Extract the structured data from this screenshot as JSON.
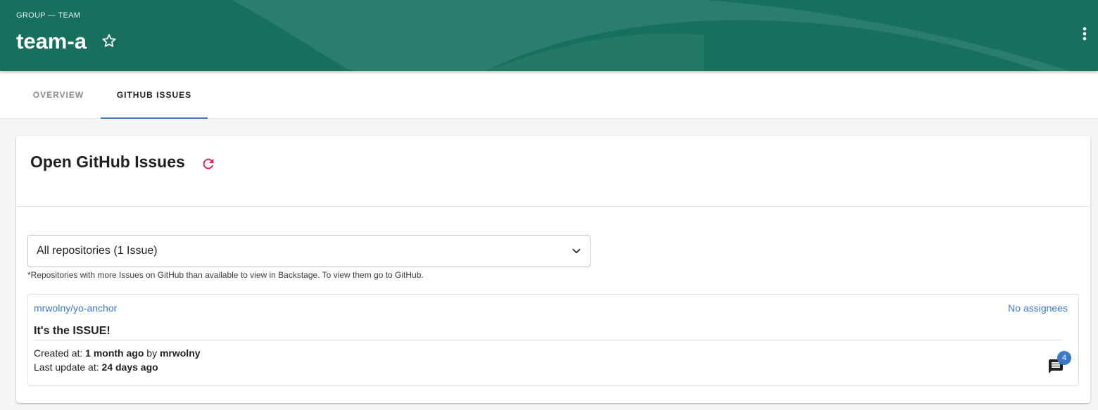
{
  "header": {
    "subtitle": "GROUP — TEAM",
    "title": "team-a",
    "colors": {
      "background": "#17705e",
      "wave": "#3c8a7a"
    }
  },
  "tabs": [
    {
      "label": "OVERVIEW",
      "active": false
    },
    {
      "label": "GITHUB ISSUES",
      "active": true
    }
  ],
  "card": {
    "title": "Open GitHub Issues",
    "refresh_icon_color": "#e8195a",
    "repository_select": {
      "selected": "All repositories (1 Issue)"
    },
    "helper_text": "*Repositories with more Issues on GitHub than available to view in Backstage. To view them go to GitHub.",
    "issues": [
      {
        "repo": "mrwolny/yo-anchor",
        "assignees": "No assignees",
        "title": "It's the ISSUE!",
        "created_label": "Created at: ",
        "created_value": "1 month ago",
        "by_label": " by ",
        "author": "mrwolny",
        "updated_label": "Last update at: ",
        "updated_value": "24 days ago",
        "comment_count": "4"
      }
    ]
  },
  "icons": {
    "star": "star-outline-icon",
    "more": "more-vertical-icon",
    "refresh": "refresh-icon",
    "chevron": "chevron-down-icon",
    "comments": "comment-icon"
  }
}
